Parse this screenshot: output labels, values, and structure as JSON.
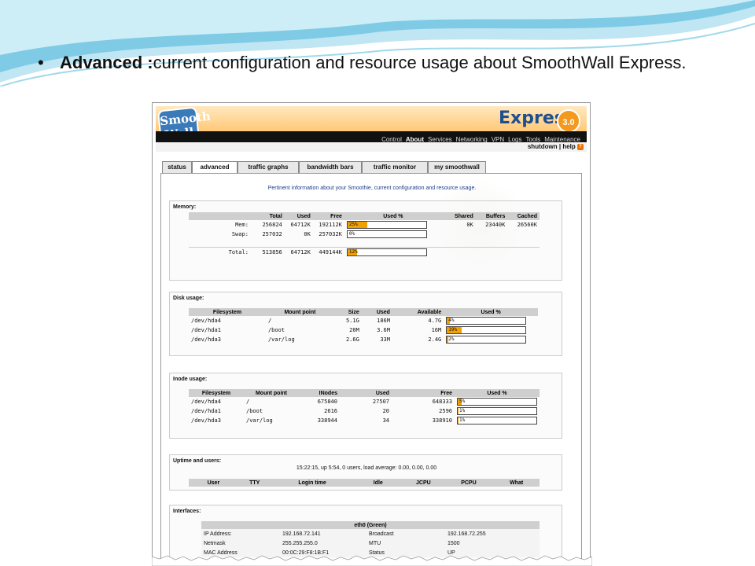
{
  "slide": {
    "bullet": "•",
    "heading_bold": "Advanced :",
    "heading_rest": "current configuration and resource usage about SmoothWall Express."
  },
  "header": {
    "logo_line1": "Smooth",
    "logo_line2": "Wall",
    "brand": "Express",
    "version": "3.0",
    "nav": [
      "Control",
      "About",
      "Services",
      "Networking",
      "VPN",
      "Logs",
      "Tools",
      "Maintenance"
    ],
    "nav_active": "About",
    "subnav": "shutdown | help",
    "help_icon": "question-icon"
  },
  "tabs": [
    "status",
    "advanced",
    "traffic graphs",
    "bandwidth bars",
    "traffic monitor",
    "my smoothwall"
  ],
  "intro": "Pertinent information about your Smoothie, current configuration and resource usage.",
  "memory": {
    "title": "Memory:",
    "headers": [
      "",
      "Total",
      "Used",
      "Free",
      "Used %",
      "Shared",
      "Buffers",
      "Cached"
    ],
    "rows": [
      {
        "label": "Mem:",
        "total": "256824",
        "used": "64712K",
        "free": "192112K",
        "pct": 25,
        "pct_label": "25%",
        "shared": "0K",
        "buffers": "23440K",
        "cached": "26560K"
      },
      {
        "label": "Swap:",
        "total": "257032",
        "used": "0K",
        "free": "257032K",
        "pct": 0,
        "pct_label": "0%",
        "shared": "",
        "buffers": "",
        "cached": ""
      }
    ],
    "total": {
      "label": "Total:",
      "total": "513856",
      "used": "64712K",
      "free": "449144K",
      "pct": 12,
      "pct_label": "12%"
    }
  },
  "disk": {
    "title": "Disk usage:",
    "headers": [
      "Filesystem",
      "Mount point",
      "Size",
      "Used",
      "Available",
      "Used %"
    ],
    "rows": [
      {
        "fs": "/dev/hda4",
        "mount": "/",
        "size": "5.1G",
        "used": "186M",
        "avail": "4.7G",
        "pct": 4,
        "pct_label": "4%"
      },
      {
        "fs": "/dev/hda1",
        "mount": "/boot",
        "size": "20M",
        "used": "3.6M",
        "avail": "16M",
        "pct": 19,
        "pct_label": "19%"
      },
      {
        "fs": "/dev/hda3",
        "mount": "/var/log",
        "size": "2.6G",
        "used": "33M",
        "avail": "2.4G",
        "pct": 2,
        "pct_label": "2%"
      }
    ]
  },
  "inode": {
    "title": "Inode usage:",
    "headers": [
      "Filesystem",
      "Mount point",
      "INodes",
      "Used",
      "Free",
      "Used %"
    ],
    "rows": [
      {
        "fs": "/dev/hda4",
        "mount": "/",
        "inodes": "675840",
        "used": "27507",
        "free": "648333",
        "pct": 5,
        "pct_label": "5%"
      },
      {
        "fs": "/dev/hda1",
        "mount": "/boot",
        "inodes": "2616",
        "used": "20",
        "free": "2596",
        "pct": 1,
        "pct_label": "1%"
      },
      {
        "fs": "/dev/hda3",
        "mount": "/var/log",
        "inodes": "338944",
        "used": "34",
        "free": "338910",
        "pct": 1,
        "pct_label": "1%"
      }
    ]
  },
  "uptime": {
    "title": "Uptime and users:",
    "summary": "15:22:15, up 5:54, 0 users, load average: 0.00, 0.00, 0.00",
    "headers": [
      "User",
      "TTY",
      "Login time",
      "Idle",
      "JCPU",
      "PCPU",
      "What"
    ]
  },
  "interfaces": {
    "title": "Interfaces:",
    "iface_name": "eth0 (Green)",
    "rows": [
      {
        "k1": "IP Address:",
        "v1": "192.168.72.141",
        "k2": "Broadcast",
        "v2": "192.168.72.255"
      },
      {
        "k1": "Netmask",
        "v1": "255.255.255.0",
        "k2": "MTU",
        "v2": "1500"
      },
      {
        "k1": "MAC Address",
        "v1": "00:0C:29:F8:1B:F1",
        "k2": "Status",
        "v2": "UP"
      }
    ]
  },
  "colors": {
    "accent": "#f0a000",
    "brand": "#1f4f8f",
    "nav_bg": "#111111"
  }
}
